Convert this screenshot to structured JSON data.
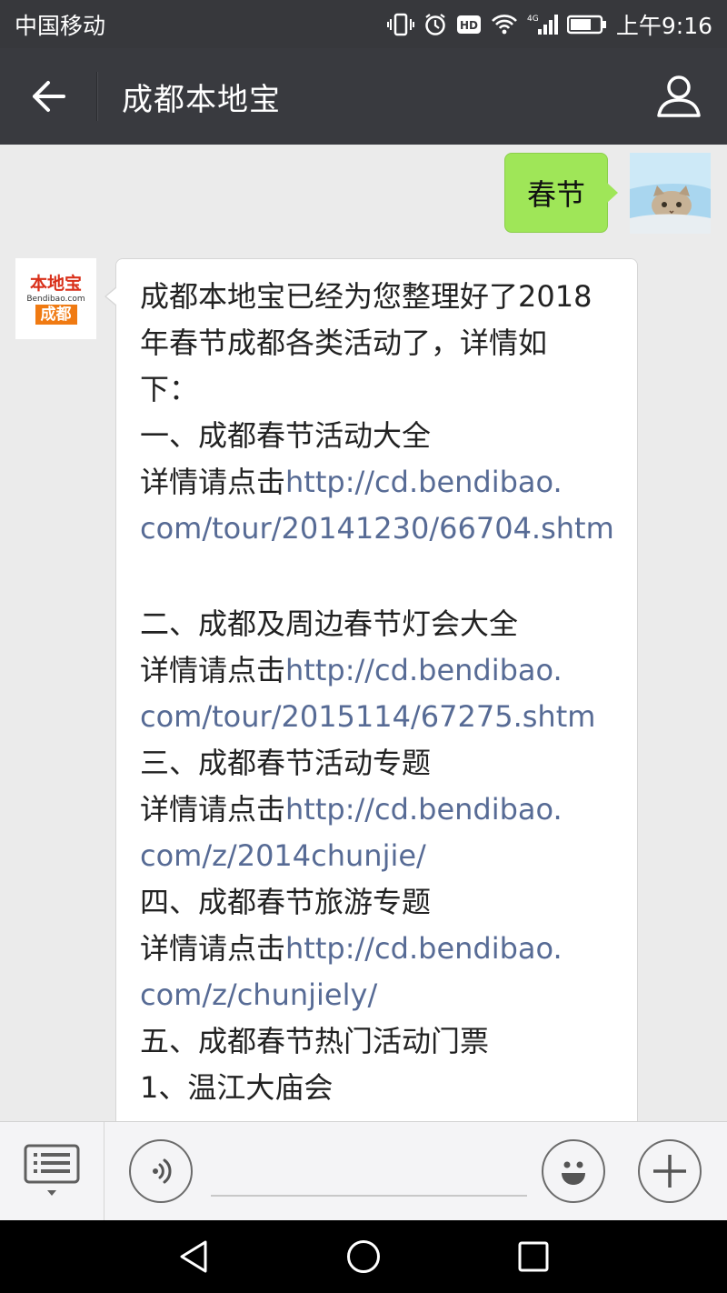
{
  "status": {
    "carrier": "中国移动",
    "time": "上午9:16",
    "network": "4G",
    "hd_label": "HD"
  },
  "header": {
    "title": "成都本地宝"
  },
  "conversation": {
    "sent_message": "春节",
    "bot_avatar": {
      "logo_top": "本地宝",
      "logo_mid": "Bendibao.com",
      "logo_bottom": "成都"
    },
    "reply": {
      "line1": "成都本地宝已经为您整理好了2018",
      "line2": "年春节成都各类活动了，详情如",
      "line3": "下：",
      "s1_title": "一、成都春节活动大全",
      "s1_prefix": "详情请点击",
      "s1_link_a": "http://cd.bendibao.",
      "s1_link_b": "com/tour/20141230/66704.shtm",
      "s2_title": "二、成都及周边春节灯会大全",
      "s2_prefix": "详情请点击",
      "s2_link_a": "http://cd.bendibao.",
      "s2_link_b": "com/tour/2015114/67275.shtm",
      "s3_title": "三、成都春节活动专题",
      "s3_prefix": "详情请点击",
      "s3_link_a": "http://cd.bendibao.",
      "s3_link_b": "com/z/2014chunjie/",
      "s4_title": "四、成都春节旅游专题",
      "s4_prefix": "详情请点击",
      "s4_link_a": "http://cd.bendibao.",
      "s4_link_b": "com/z/chunjiely/",
      "s5_title": "五、成都春节热门活动门票",
      "s5_item1": "1、温江大庙会"
    }
  },
  "input": {
    "value": "",
    "placeholder": ""
  },
  "colors": {
    "link": "#576b95",
    "sent_bubble": "#9fe658",
    "title_bar": "#393a3f"
  },
  "icons": {
    "back": "back-arrow-icon",
    "user": "person-icon",
    "menu": "keyboard-menu-icon",
    "voice": "voice-icon",
    "emoji": "smiley-icon",
    "plus": "plus-icon"
  }
}
